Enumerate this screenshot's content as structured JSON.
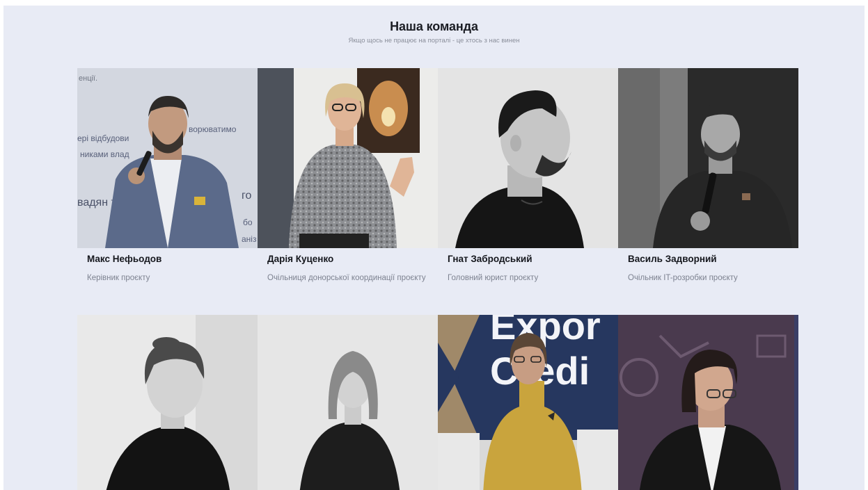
{
  "section": {
    "title": "Наша команда",
    "subtitle": "Якщо щось не працює на порталі - це хтось з нас винен"
  },
  "team": [
    {
      "name": "Макс Нефьодов",
      "role": "Керівник проєкту",
      "photo": "man-speaking-with-microphone-photo"
    },
    {
      "name": "Дарія Куценко",
      "role": "Очільниця донорської координації проєкту",
      "photo": "woman-with-glasses-waving-photo"
    },
    {
      "name": "Гнат Забродський",
      "role": "Головний юрист проєкту",
      "photo": "man-profile-portrait-photo"
    },
    {
      "name": "Василь Задворний",
      "role": "Очільник IT-розробки проєкту",
      "photo": "man-with-microphone-dark-photo"
    },
    {
      "name": "",
      "role": "",
      "photo": "woman-portrait-light-photo"
    },
    {
      "name": "",
      "role": "",
      "photo": "woman-long-hair-portrait-photo"
    },
    {
      "name": "",
      "role": "",
      "photo": "woman-yellow-sweater-photo"
    },
    {
      "name": "",
      "role": "",
      "photo": "woman-glasses-purple-background-photo"
    }
  ],
  "photo_backdrop_text": {
    "slide_fragments": [
      "енції.",
      "ері відбудови",
      "ворюватимо",
      "никами влад",
      "вадян т",
      "го",
      "бо",
      "аніз"
    ],
    "banner": [
      "Expor",
      "Credi"
    ]
  }
}
